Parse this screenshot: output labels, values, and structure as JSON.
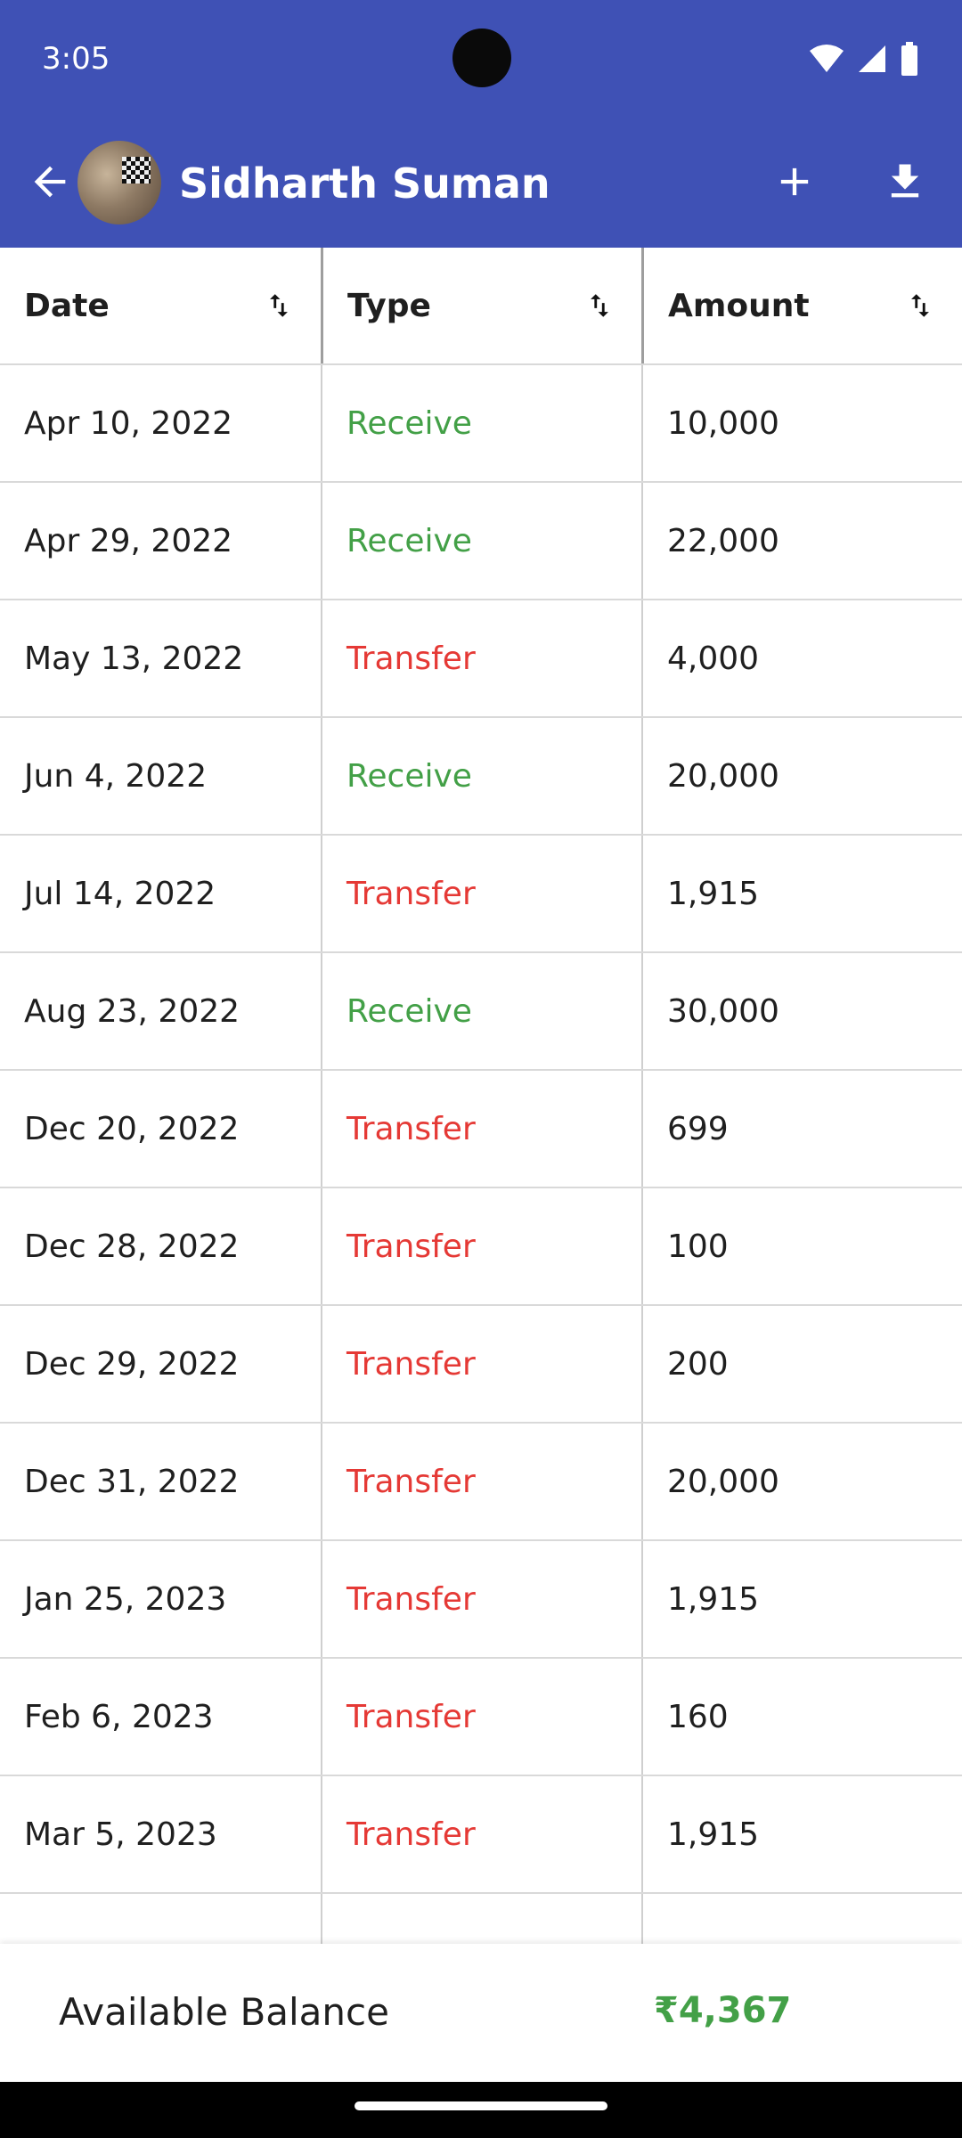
{
  "status": {
    "time": "3:05"
  },
  "header": {
    "title": "Sidharth Suman"
  },
  "columns": [
    "Date",
    "Type",
    "Amount"
  ],
  "rows": [
    {
      "date": "Apr 10, 2022",
      "type": "Receive",
      "amount": "10,000"
    },
    {
      "date": "Apr 29, 2022",
      "type": "Receive",
      "amount": "22,000"
    },
    {
      "date": "May 13, 2022",
      "type": "Transfer",
      "amount": "4,000"
    },
    {
      "date": "Jun 4, 2022",
      "type": "Receive",
      "amount": "20,000"
    },
    {
      "date": "Jul 14, 2022",
      "type": "Transfer",
      "amount": "1,915"
    },
    {
      "date": "Aug 23, 2022",
      "type": "Receive",
      "amount": "30,000"
    },
    {
      "date": "Dec 20, 2022",
      "type": "Transfer",
      "amount": "699"
    },
    {
      "date": "Dec 28, 2022",
      "type": "Transfer",
      "amount": "100"
    },
    {
      "date": "Dec 29, 2022",
      "type": "Transfer",
      "amount": "200"
    },
    {
      "date": "Dec 31, 2022",
      "type": "Transfer",
      "amount": "20,000"
    },
    {
      "date": "Jan 25, 2023",
      "type": "Transfer",
      "amount": "1,915"
    },
    {
      "date": "Feb 6, 2023",
      "type": "Transfer",
      "amount": "160"
    },
    {
      "date": "Mar 5, 2023",
      "type": "Transfer",
      "amount": "1,915"
    }
  ],
  "footer": {
    "label": "Available Balance",
    "value": "₹4,367"
  },
  "colors": {
    "appbar": "#3f51b5",
    "receive": "#43a047",
    "transfer": "#e53935"
  }
}
